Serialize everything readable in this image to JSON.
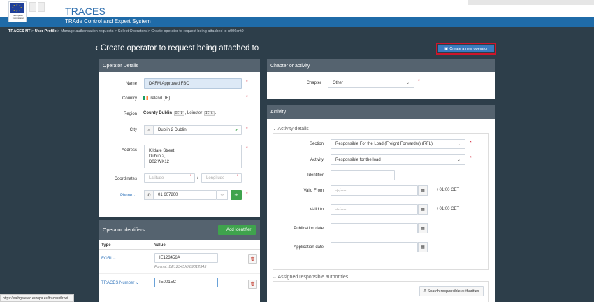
{
  "header": {
    "app_title": "TRACES",
    "app_subtitle": "TRAde Control and Expert System",
    "eu_caption": "European Commission"
  },
  "breadcrumb": {
    "root": "TRACES NT",
    "items": [
      "User Profile",
      "Manage authorisation requests",
      "Select Operators",
      "Create operator to request being attached to n006cnt9"
    ]
  },
  "page": {
    "title": "Create operator to request being attached to",
    "create_button": "Create a new operator"
  },
  "operator_details": {
    "heading": "Operator Details",
    "name_label": "Name",
    "name_value": "DAFM Approved FBO",
    "country_label": "Country",
    "country_value": "Ireland (IE)",
    "region_label": "Region",
    "region_county": "County Dublin",
    "region_county_code": "IE-D",
    "region_province": "Leinster",
    "region_province_code": "IE-L",
    "city_label": "City",
    "city_value": "Dublin 2 Dublin",
    "address_label": "Address",
    "address_lines": [
      "Kildare Street,",
      "Dublin 2,",
      "D02 WK12"
    ],
    "coordinates_label": "Coordinates",
    "latitude_placeholder": "Latitude",
    "longitude_placeholder": "Longitude",
    "phone_label": "Phone",
    "phone_value": "01 607200"
  },
  "operator_identifiers": {
    "heading": "Operator Identifiers",
    "add_button": "Add Identifier",
    "col_type": "Type",
    "col_value": "Value",
    "rows": [
      {
        "type": "EORI",
        "value": "IE123456A",
        "hint": "Format: BE12345X789012345"
      },
      {
        "type": "TRACES.Number",
        "value": "IE001EC",
        "hint": ""
      }
    ]
  },
  "chapter": {
    "heading": "Chapter or activity",
    "chapter_label": "Chapter",
    "chapter_value": "Other"
  },
  "activity": {
    "heading": "Activity",
    "details_title": "Activity details",
    "section_label": "Section",
    "section_value": "Responsible For the Load (Freight Forwarder) (RFL)",
    "activity_label": "Activity",
    "activity_value": "Responsible for the load",
    "identifier_label": "Identifier",
    "valid_from_label": "Valid From",
    "valid_from_placeholder": "-/-/----",
    "valid_from_tz": "+01:00 CET",
    "valid_to_label": "Valid to",
    "valid_to_placeholder": "-/-/----",
    "valid_to_tz": "+01:00 CET",
    "publication_label": "Publication date",
    "application_label": "Application date",
    "authorities_title": "Assigned responsible authorities",
    "search_button": "Search responsible authorities"
  },
  "status_url": "https://webgate.ec.europa.eu/tracesnt/root"
}
